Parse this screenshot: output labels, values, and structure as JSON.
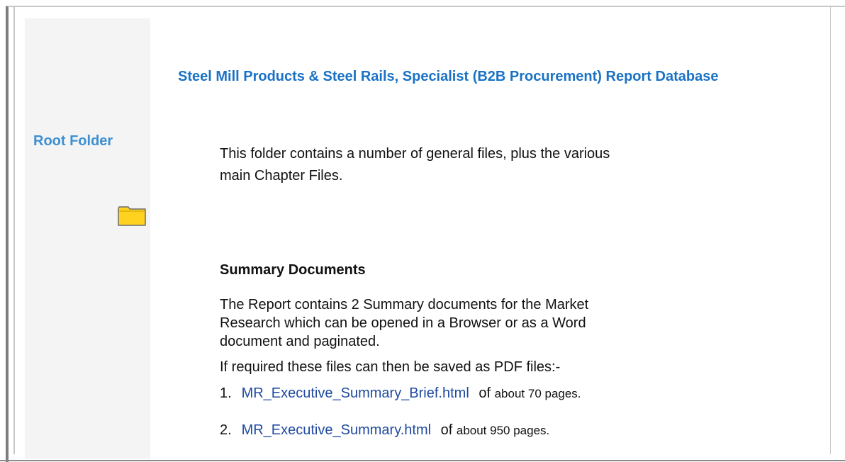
{
  "left": {
    "title": "Root Folder",
    "icon": "folder-icon"
  },
  "main": {
    "title": "Steel Mill Products & Steel Rails, Specialist (B2B Procurement) Report Database",
    "intro": "This folder contains a number of general files, plus the various main Chapter Files.",
    "section_heading": "Summary Documents",
    "paragraph1": "The Report contains 2 Summary documents for the Market Research which can be opened in a Browser or as a Word document and paginated.",
    "paragraph2": "If required these files can then be saved as PDF files:-",
    "items": [
      {
        "number": "1.",
        "link": "MR_Executive_Summary_Brief.html",
        "of": "of",
        "rest": "about 70 pages."
      },
      {
        "number": "2.",
        "link": "MR_Executive_Summary.html",
        "of": "of",
        "rest": "about 950 pages."
      }
    ]
  },
  "colors": {
    "left_title": "#3d8fd3",
    "main_title": "#1a72c5",
    "link": "#1f4aa0",
    "folder": "#ffd21f",
    "panel_bg": "#f4f4f4"
  }
}
